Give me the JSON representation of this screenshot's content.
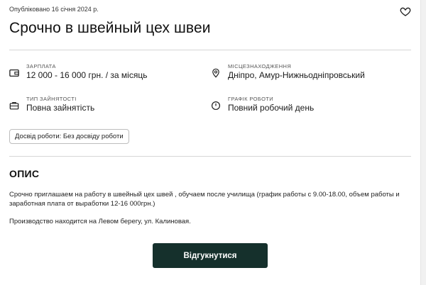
{
  "vacancy": {
    "published": "Опубліковано 16 січня 2024 р.",
    "title": "Срочно в швейный цех швеи"
  },
  "details": {
    "salary": {
      "label": "ЗАРПЛАТА",
      "value": "12 000 - 16 000 грн. / за місяць",
      "icon": "wallet-icon"
    },
    "location": {
      "label": "МІСЦЕЗНАХОДЖЕННЯ",
      "value": "Дніпро, Амур-Нижньодніпровський",
      "icon": "location-pin-icon"
    },
    "employment": {
      "label": "ТИП ЗАЙНЯТОСТІ",
      "value": "Повна зайнятість",
      "icon": "briefcase-icon"
    },
    "schedule": {
      "label": "ГРАФІК РОБОТИ",
      "value": "Повний робочий день",
      "icon": "clock-icon"
    }
  },
  "experience_chip": "Досвід роботи: Без досвіду роботи",
  "description": {
    "heading": "ОПИС",
    "paragraph1": "Срочно приглашаем на работу в швейный цех швей , обучаем после училища (график работы с 9.00-18.00, объем работы и заработная плата от выработки 12-16 000грн.)",
    "paragraph2": "Производство находится на Левом берегу, ул. Калиновая."
  },
  "actions": {
    "apply_label": "Відгукнутися"
  }
}
